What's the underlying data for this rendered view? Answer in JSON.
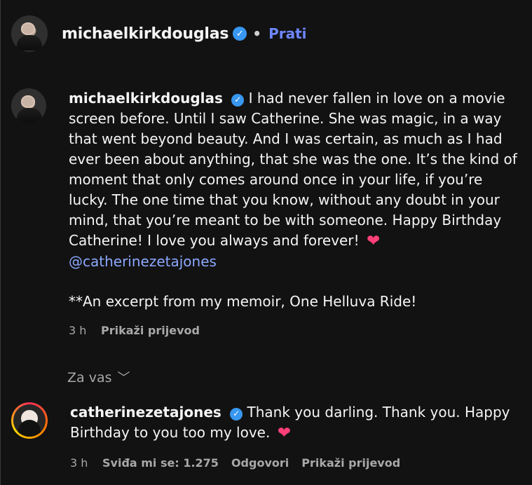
{
  "header": {
    "username": "michaelkirkdouglas",
    "separator": "•",
    "follow_label": "Prati"
  },
  "post": {
    "username": "michaelkirkdouglas",
    "caption_part1": "I had never fallen in love on a movie screen before. Until I saw Catherine. She was magic, in a way that went beyond beauty. And I was certain, as much as I had ever been about anything, that she was the one. It’s the kind of moment that only comes around once in your life, if you’re lucky. The one time that you know, without any doubt in your mind, that you’re meant to be with someone. Happy Birthday Catherine! I love you always and forever!",
    "heart_icon": "heart-icon",
    "mention": "@catherinezetajones",
    "excerpt": "**An excerpt from my memoir, One Helluva Ride!",
    "time": "3 h",
    "translate_label": "Prikaži prijevod"
  },
  "filter": {
    "label": "Za vas",
    "chevron_icon": "chevron-down-icon"
  },
  "comment": {
    "username": "catherinezetajones",
    "text": "Thank you darling. Thank you. Happy Birthday to you too my love.",
    "heart_icon": "heart-icon",
    "time": "3 h",
    "likes_label": "Sviđa mi se: 1.275",
    "reply_label": "Odgovori",
    "translate_label": "Prikaži prijevod"
  },
  "colors": {
    "background": "#121212",
    "text": "#f5f5f5",
    "muted": "#a8a8a8",
    "link": "#8ca8ff",
    "accent": "#6e87ff",
    "heart": "#ff3f78",
    "verified": "#3897f0"
  }
}
